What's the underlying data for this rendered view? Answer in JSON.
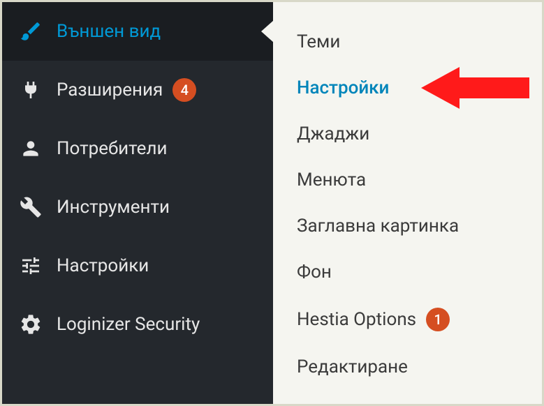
{
  "sidebar": {
    "items": [
      {
        "label": "Външен вид",
        "icon": "brush-icon",
        "active": true,
        "badge": null
      },
      {
        "label": "Разширения",
        "icon": "plug-icon",
        "active": false,
        "badge": "4"
      },
      {
        "label": "Потребители",
        "icon": "user-icon",
        "active": false,
        "badge": null
      },
      {
        "label": "Инструменти",
        "icon": "wrench-icon",
        "active": false,
        "badge": null
      },
      {
        "label": "Настройки",
        "icon": "sliders-icon",
        "active": false,
        "badge": null
      },
      {
        "label": "Loginizer Security",
        "icon": "gear-icon",
        "active": false,
        "badge": null
      }
    ]
  },
  "submenu": {
    "items": [
      {
        "label": "Теми",
        "highlighted": false,
        "badge": null
      },
      {
        "label": "Настройки",
        "highlighted": true,
        "badge": null
      },
      {
        "label": "Джаджи",
        "highlighted": false,
        "badge": null
      },
      {
        "label": "Менюта",
        "highlighted": false,
        "badge": null
      },
      {
        "label": "Заглавна картинка",
        "highlighted": false,
        "badge": null
      },
      {
        "label": "Фон",
        "highlighted": false,
        "badge": null
      },
      {
        "label": "Hestia Options",
        "highlighted": false,
        "badge": "1"
      },
      {
        "label": "Редактиране",
        "highlighted": false,
        "badge": null
      }
    ]
  },
  "colors": {
    "accent": "#0099d6",
    "badge": "#d54e21",
    "arrow": "#ff1a1a"
  }
}
